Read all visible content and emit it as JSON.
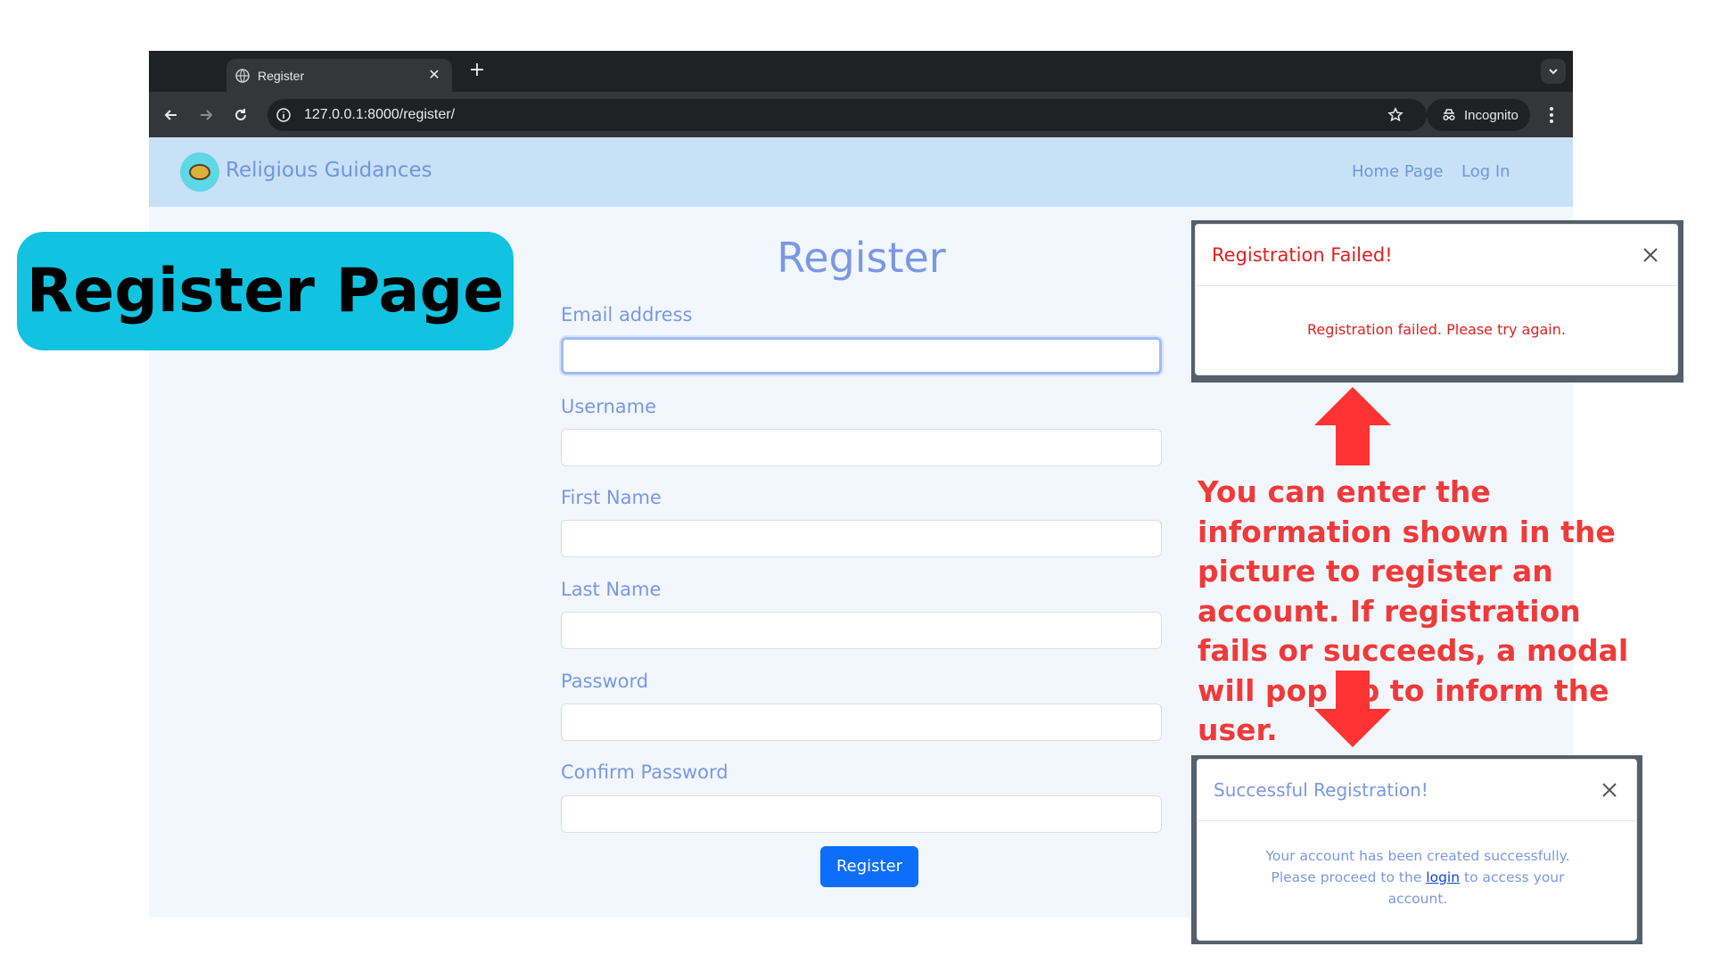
{
  "browser": {
    "tab_title": "Register",
    "url": "127.0.0.1:8000/register/",
    "incognito_label": "Incognito"
  },
  "navbar": {
    "brand": "Religious Guidances",
    "links": [
      "Home Page",
      "Log In"
    ]
  },
  "form": {
    "title": "Register",
    "fields": [
      {
        "label": "Email address"
      },
      {
        "label": "Username"
      },
      {
        "label": "First Name"
      },
      {
        "label": "Last Name"
      },
      {
        "label": "Password"
      },
      {
        "label": "Confirm Password"
      }
    ],
    "submit_label": "Register"
  },
  "annotations": {
    "callout": "Register Page",
    "note": "You can enter the information shown in the picture to register an account. If registration fails or succeeds, a modal will pop up to inform the user."
  },
  "modals": {
    "failed": {
      "title": "Registration Failed!",
      "body": "Registration failed. Please try again.",
      "color": "#e02020"
    },
    "success": {
      "title": "Successful Registration!",
      "body_before": "Your account has been created successfully. Please proceed to the",
      "link_text": "login",
      "body_after": "to access your account.",
      "color": "#7a98e3"
    }
  },
  "colors": {
    "accent": "#0d6efd",
    "arrow": "#ff3333",
    "callout_bg": "#11c3e0"
  }
}
